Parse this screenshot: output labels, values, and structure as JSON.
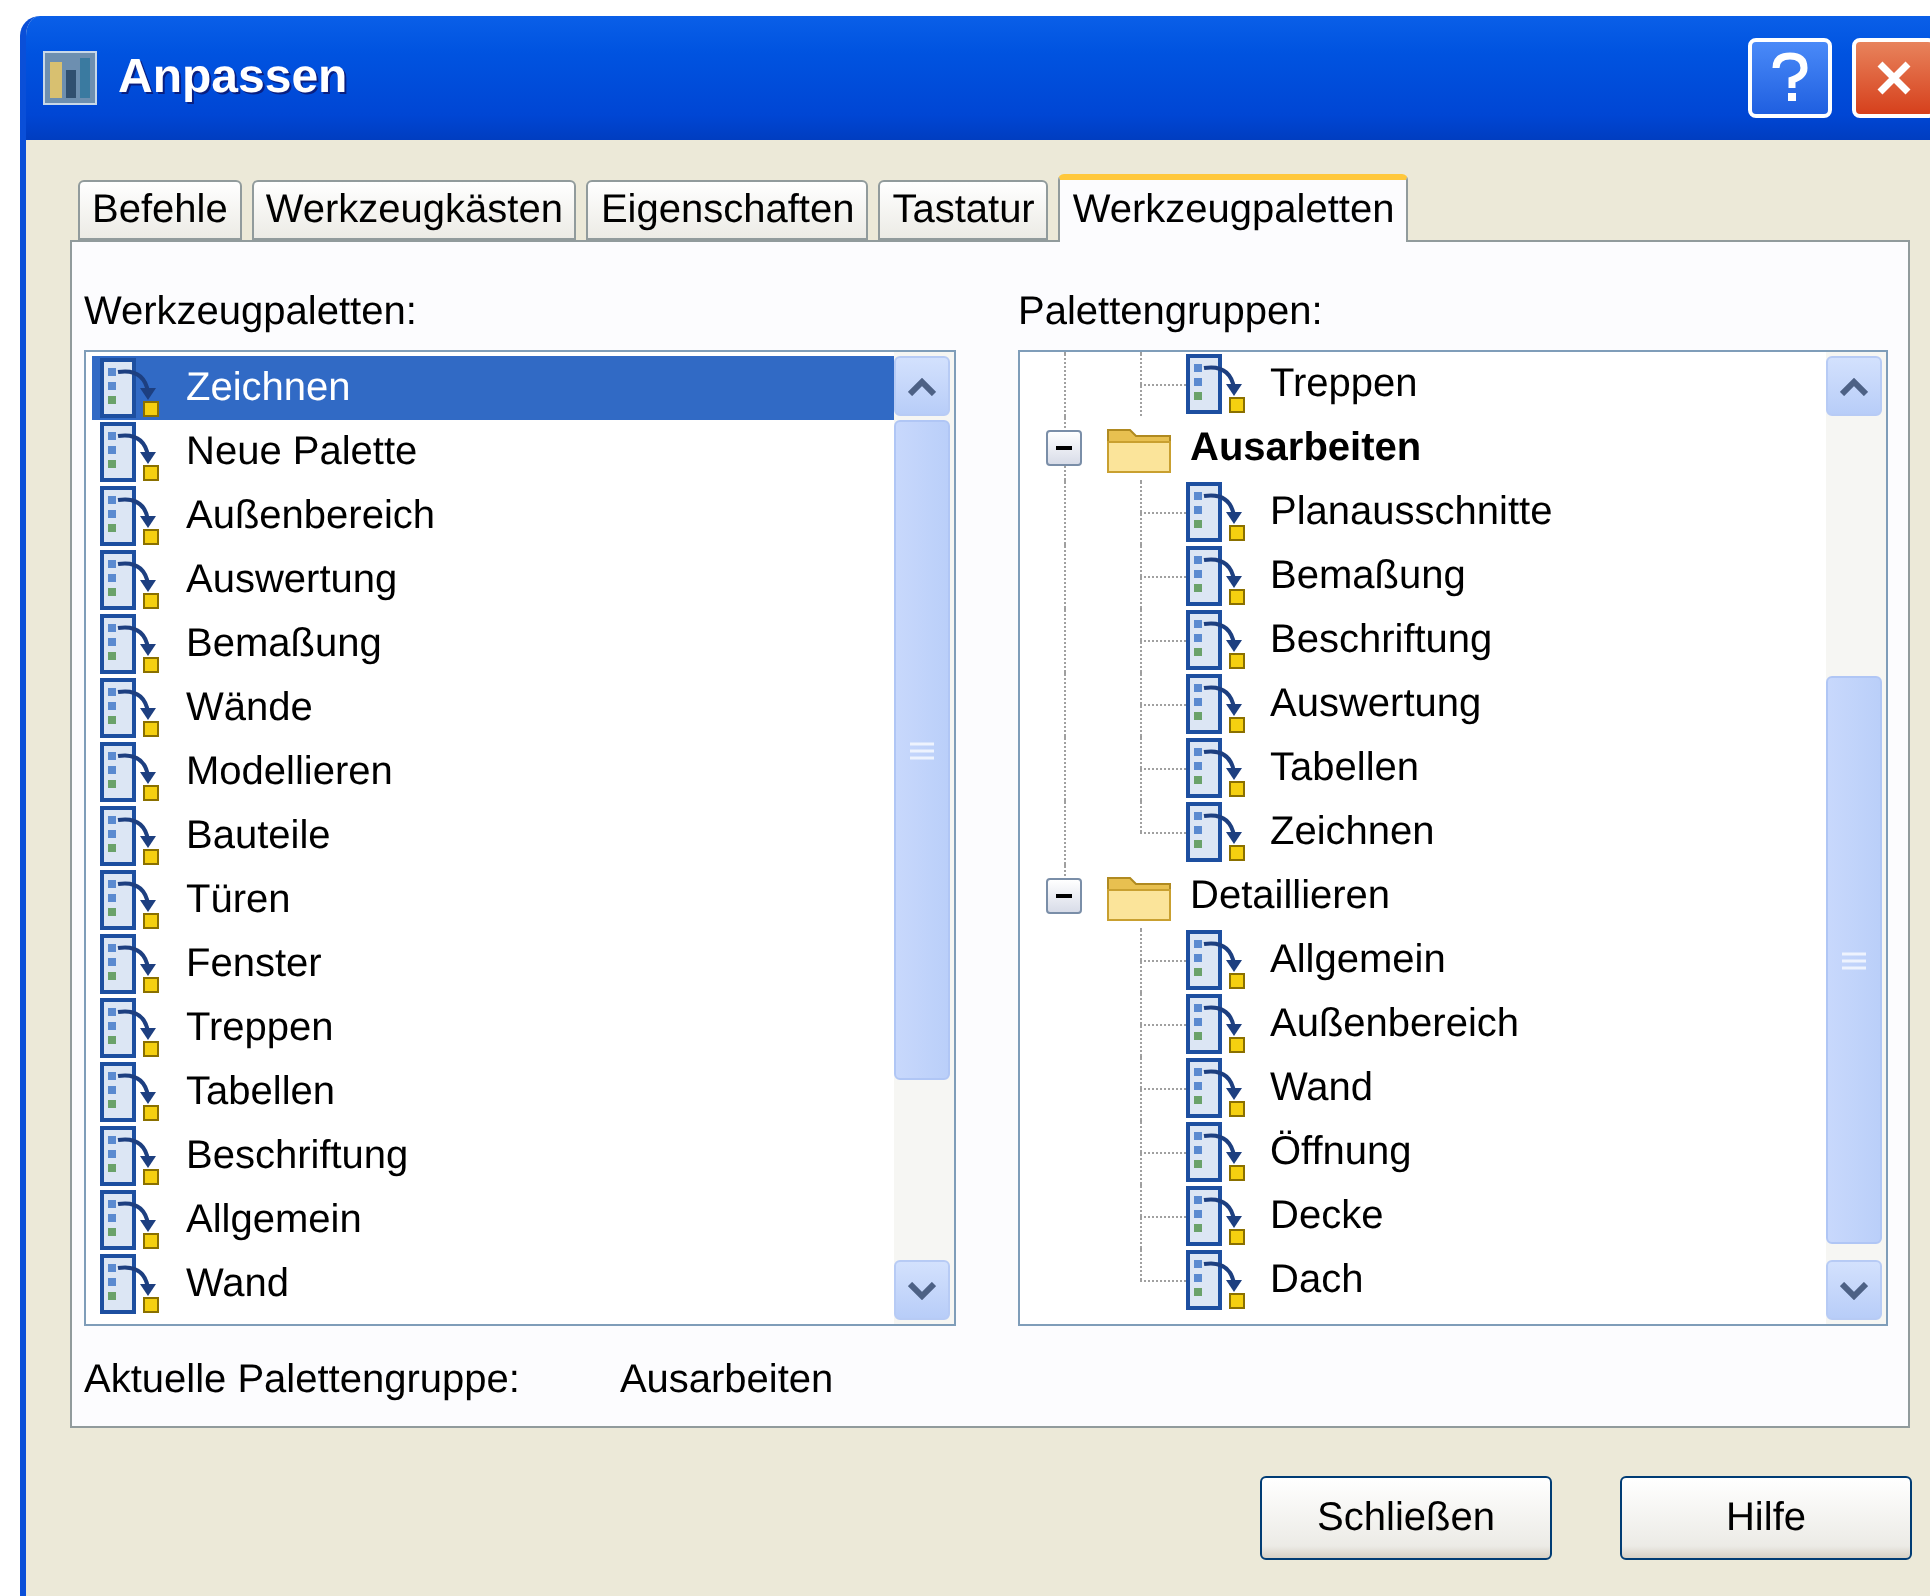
{
  "window": {
    "title": "Anpassen"
  },
  "tabs": [
    {
      "label": "Befehle",
      "selected": false
    },
    {
      "label": "Werkzeugkästen",
      "selected": false
    },
    {
      "label": "Eigenschaften",
      "selected": false
    },
    {
      "label": "Tastatur",
      "selected": false
    },
    {
      "label": "Werkzeugpaletten",
      "selected": true
    }
  ],
  "palettes": {
    "label": "Werkzeugpaletten:",
    "items": [
      {
        "label": "Zeichnen",
        "selected": true
      },
      {
        "label": "Neue Palette",
        "selected": false
      },
      {
        "label": "Außenbereich",
        "selected": false
      },
      {
        "label": "Auswertung",
        "selected": false
      },
      {
        "label": "Bemaßung",
        "selected": false
      },
      {
        "label": "Wände",
        "selected": false
      },
      {
        "label": "Modellieren",
        "selected": false
      },
      {
        "label": "Bauteile",
        "selected": false
      },
      {
        "label": "Türen",
        "selected": false
      },
      {
        "label": "Fenster",
        "selected": false
      },
      {
        "label": "Treppen",
        "selected": false
      },
      {
        "label": "Tabellen",
        "selected": false
      },
      {
        "label": "Beschriftung",
        "selected": false
      },
      {
        "label": "Allgemein",
        "selected": false
      },
      {
        "label": "Wand",
        "selected": false
      }
    ]
  },
  "groups": {
    "label": "Palettengruppen:",
    "items": [
      {
        "kind": "palette",
        "label": "Treppen"
      },
      {
        "kind": "group",
        "label": "Ausarbeiten",
        "current": true,
        "expanded": true,
        "children": [
          {
            "label": "Planausschnitte"
          },
          {
            "label": "Bemaßung"
          },
          {
            "label": "Beschriftung"
          },
          {
            "label": "Auswertung"
          },
          {
            "label": "Tabellen"
          },
          {
            "label": "Zeichnen"
          }
        ]
      },
      {
        "kind": "group",
        "label": "Detaillieren",
        "current": false,
        "expanded": true,
        "children": [
          {
            "label": "Allgemein"
          },
          {
            "label": "Außenbereich"
          },
          {
            "label": "Wand"
          },
          {
            "label": "Öffnung"
          },
          {
            "label": "Decke"
          },
          {
            "label": "Dach"
          }
        ]
      }
    ]
  },
  "current_group": {
    "label": "Aktuelle Palettengruppe:",
    "value": "Ausarbeiten"
  },
  "buttons": [
    "Schließen",
    "Hilfe"
  ]
}
